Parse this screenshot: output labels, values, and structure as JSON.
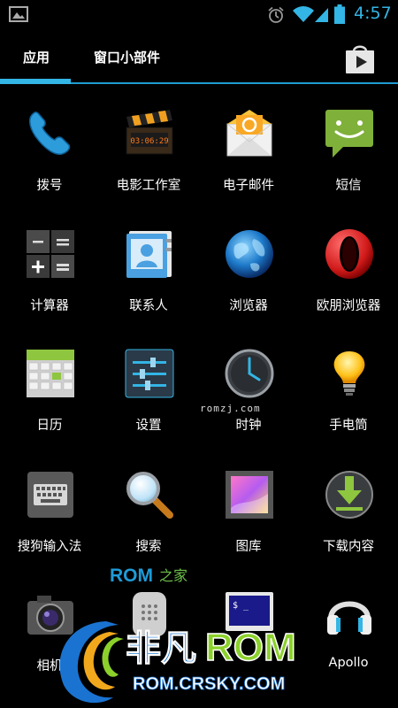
{
  "status_bar": {
    "time": "4:57",
    "icons": [
      "picture-icon",
      "alarm-icon",
      "wifi-icon",
      "signal-icon",
      "battery-icon"
    ]
  },
  "tabs": [
    {
      "label": "应用",
      "active": true
    },
    {
      "label": "窗口小部件",
      "active": false
    }
  ],
  "store_icon": "play-store-icon",
  "apps": [
    {
      "label": "拨号",
      "icon": "phone-icon"
    },
    {
      "label": "电影工作室",
      "icon": "clapperboard-icon",
      "icon_text": "03:06:29"
    },
    {
      "label": "电子邮件",
      "icon": "email-icon"
    },
    {
      "label": "短信",
      "icon": "sms-icon"
    },
    {
      "label": "计算器",
      "icon": "calculator-icon"
    },
    {
      "label": "联系人",
      "icon": "contacts-icon"
    },
    {
      "label": "浏览器",
      "icon": "browser-globe-icon"
    },
    {
      "label": "欧朋浏览器",
      "icon": "opera-icon"
    },
    {
      "label": "日历",
      "icon": "calendar-icon"
    },
    {
      "label": "设置",
      "icon": "settings-sliders-icon"
    },
    {
      "label": "时钟",
      "icon": "clock-icon"
    },
    {
      "label": "手电筒",
      "icon": "flashlight-bulb-icon"
    },
    {
      "label": "搜狗输入法",
      "icon": "keyboard-icon"
    },
    {
      "label": "搜索",
      "icon": "magnifier-icon"
    },
    {
      "label": "图库",
      "icon": "gallery-icon"
    },
    {
      "label": "下载内容",
      "icon": "download-icon"
    },
    {
      "label": "相机",
      "icon": "camera-icon"
    },
    {
      "label": "",
      "icon": "voice-icon"
    },
    {
      "label": "",
      "icon": "terminal-icon",
      "icon_text": "$ _"
    },
    {
      "label": "Apollo",
      "icon": "headphones-icon"
    }
  ],
  "watermarks": {
    "site_small": "romzj.com",
    "rom_zhijia_rom": "ROM",
    "rom_zhijia_cn": "之家",
    "feifan_cn": "非凡",
    "feifan_rom": "ROM",
    "feifan_url": "ROM.CRSKY.COM"
  },
  "colors": {
    "accent": "#33b5e5",
    "background": "#000000",
    "watermark_green": "#8cd12b",
    "watermark_blue": "#1a73d1"
  }
}
